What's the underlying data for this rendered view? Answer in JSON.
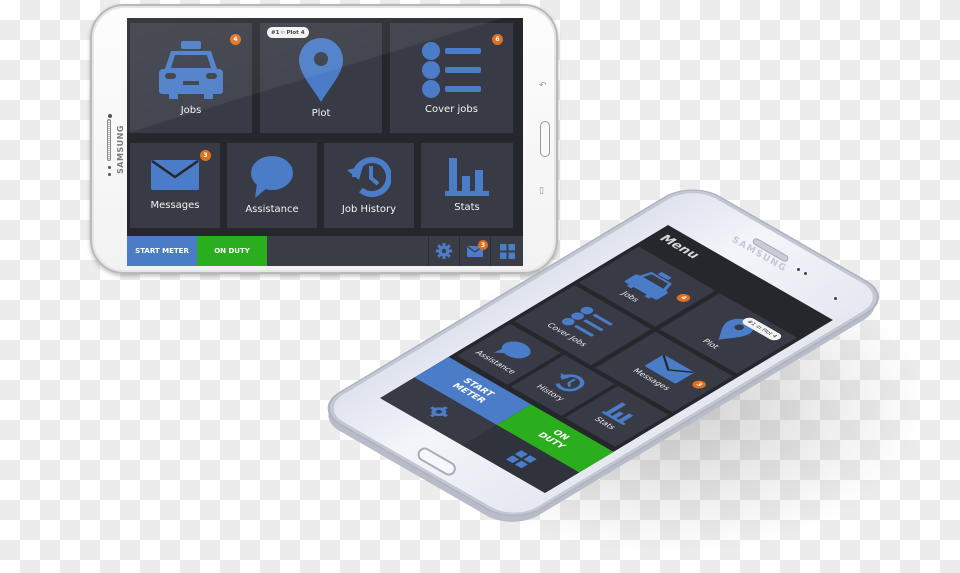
{
  "colors": {
    "tile": "#383b45",
    "screen_bg": "#25272c",
    "icon_blue": "#4a7cc8",
    "badge_orange": "#e07021",
    "start_meter_blue": "#4a7cc8",
    "on_duty_green": "#2aae1e"
  },
  "tablet": {
    "brand": "SAMSUNG",
    "tiles": [
      {
        "label": "Jobs",
        "icon": "taxi-icon",
        "badge": "4"
      },
      {
        "label": "Plot",
        "icon": "map-pin-icon",
        "pill": {
          "rank": "#1",
          "in": "in",
          "plot": "Plot 4"
        }
      },
      {
        "label": "Cover jobs",
        "icon": "list-icon",
        "badge": "6"
      },
      {
        "label": "Messages",
        "icon": "envelope-icon",
        "badge": "3"
      },
      {
        "label": "Assistance",
        "icon": "speech-bubble-icon"
      },
      {
        "label": "Job History",
        "icon": "history-clock-icon"
      },
      {
        "label": "Stats",
        "icon": "bar-chart-icon"
      }
    ],
    "bottom_bar": {
      "start_meter": "START METER",
      "on_duty": "ON DUTY",
      "messages_badge": "3"
    }
  },
  "phone": {
    "brand": "SAMSUNG",
    "header": "Menu",
    "tiles": [
      {
        "label": "Jobs",
        "icon": "taxi-icon",
        "badge": "4"
      },
      {
        "label": "Plot",
        "icon": "map-pin-icon",
        "pill": "#1 in Plot 4"
      },
      {
        "label": "Cover Jobs",
        "icon": "list-icon"
      },
      {
        "label": "Messages",
        "icon": "envelope-icon",
        "badge": "3"
      },
      {
        "label": "Assistance",
        "icon": "speech-bubble-icon"
      },
      {
        "label": "History",
        "icon": "history-clock-icon"
      },
      {
        "label": "Stats",
        "icon": "bar-chart-icon"
      }
    ],
    "bottom": {
      "start_meter_line1": "START",
      "start_meter_line2": "METER",
      "on_duty_line1": "ON",
      "on_duty_line2": "DUTY"
    }
  }
}
